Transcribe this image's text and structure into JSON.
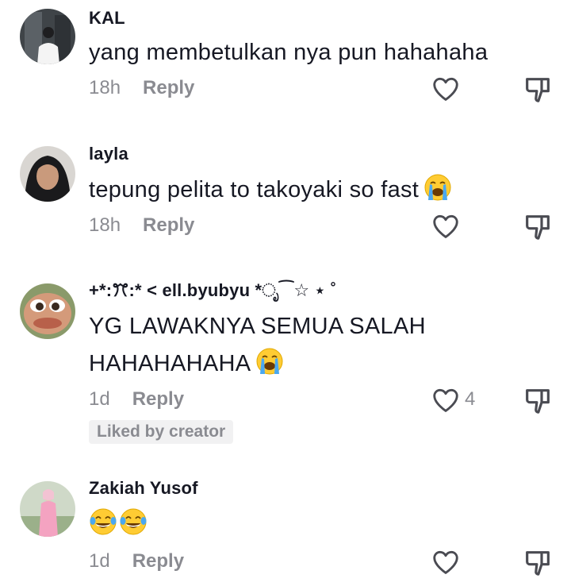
{
  "comments": [
    {
      "username": "KAL",
      "text": "yang membetulkan nya pun hahahaha",
      "time": "18h",
      "reply_label": "Reply",
      "avatar_icon": "avatar-photo-person-white-shirt"
    },
    {
      "username": "layla",
      "text": "tepung pelita to takoyaki so fast",
      "emoji": "loudly-crying-face",
      "time": "18h",
      "reply_label": "Reply",
      "avatar_icon": "avatar-photo-woman-hijab"
    },
    {
      "username": "+*:ꔫ:* <  ell.byubyu *ೃ⁀☆ ⋆ ˚",
      "text_line1": "YG LAWAKNYA SEMUA SALAH",
      "text_line2": "HAHAHAHAHA",
      "emoji": "loudly-crying-face",
      "time": "1d",
      "reply_label": "Reply",
      "like_count": "4",
      "badge": "Liked by creator",
      "avatar_icon": "avatar-cartoon-face"
    },
    {
      "username": "Zakiah Yusof",
      "emojis": [
        "face-with-tears-of-joy",
        "face-with-tears-of-joy"
      ],
      "time": "1d",
      "reply_label": "Reply",
      "avatar_icon": "avatar-photo-woman-pink-dress"
    }
  ],
  "colors": {
    "text": "#161823",
    "meta": "#8a8b91",
    "icon": "#4a4b52",
    "badge_bg": "#f1f1f2"
  }
}
